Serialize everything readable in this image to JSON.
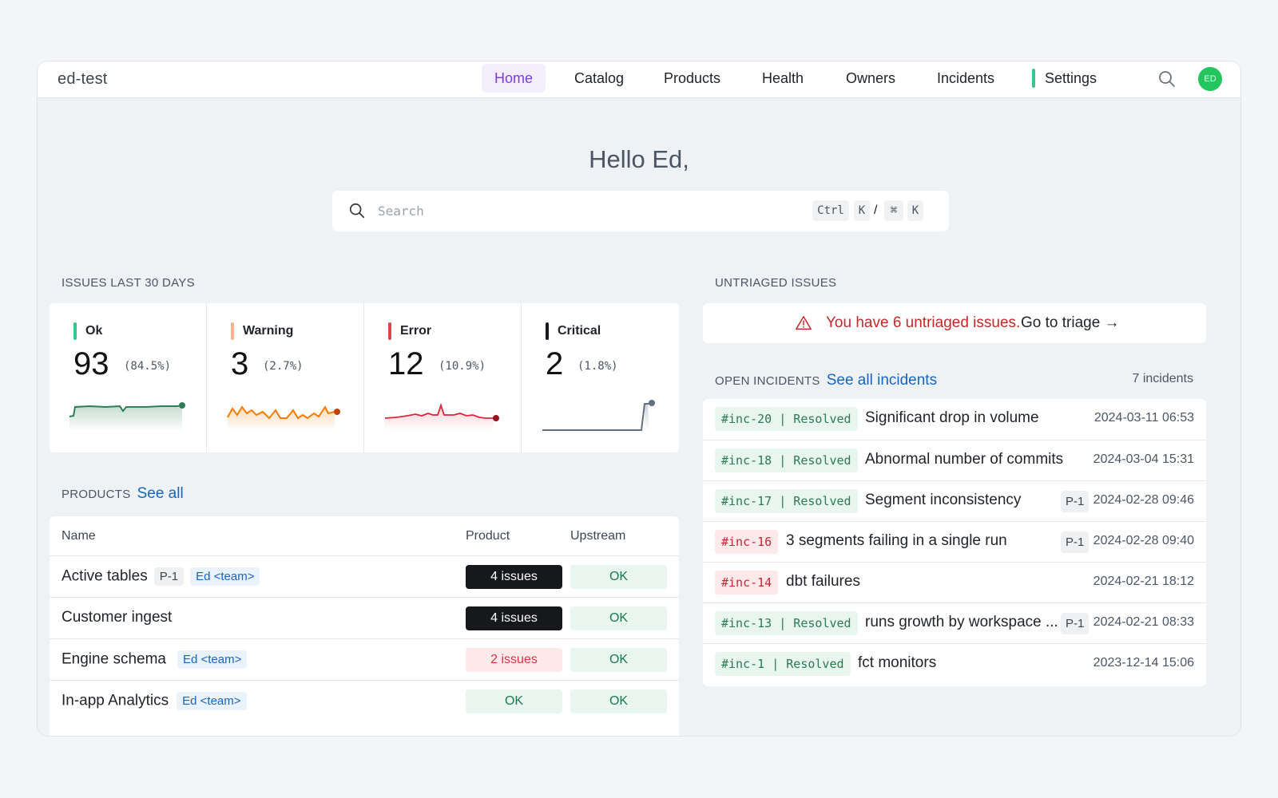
{
  "app": {
    "workspace": "ed-test",
    "avatar_initials": "ED"
  },
  "nav": {
    "items": [
      {
        "label": "Home",
        "active": true
      },
      {
        "label": "Catalog"
      },
      {
        "label": "Products"
      },
      {
        "label": "Health"
      },
      {
        "label": "Owners"
      },
      {
        "label": "Incidents"
      },
      {
        "label": "Settings"
      }
    ]
  },
  "greeting": "Hello Ed,",
  "search": {
    "placeholder": "Search",
    "shortcut": {
      "ctrl": "Ctrl",
      "k": "K",
      "slash": "/",
      "cmd": "⌘",
      "k2": "K"
    }
  },
  "issues": {
    "title": "ISSUES LAST 30 DAYS",
    "stats": [
      {
        "label": "Ok",
        "count": "93",
        "pct": "(84.5%)",
        "color": "#3cc48f"
      },
      {
        "label": "Warning",
        "count": "3",
        "pct": "(2.7%)",
        "color": "#f9b48a"
      },
      {
        "label": "Error",
        "count": "12",
        "pct": "(10.9%)",
        "color": "#e0474c"
      },
      {
        "label": "Critical",
        "count": "2",
        "pct": "(1.8%)",
        "color": "#16181b"
      }
    ]
  },
  "products": {
    "title": "PRODUCTS",
    "see_all": "See all",
    "columns": {
      "name": "Name",
      "product": "Product",
      "upstream": "Upstream"
    },
    "rows": [
      {
        "name": "Active tables",
        "priority": "P-1",
        "team": "Ed <team>",
        "product": "4 issues",
        "product_status": "dark",
        "upstream": "OK"
      },
      {
        "name": "Customer ingest",
        "priority": "",
        "team": "",
        "product": "4 issues",
        "product_status": "dark",
        "upstream": "OK"
      },
      {
        "name": "Engine schema",
        "priority": "",
        "team": "Ed <team>",
        "product": "2 issues",
        "product_status": "err",
        "upstream": "OK"
      },
      {
        "name": "In-app Analytics",
        "priority": "",
        "team": "Ed <team>",
        "product": "OK",
        "product_status": "ok",
        "upstream": "OK"
      }
    ]
  },
  "untriaged": {
    "title": "UNTRIAGED ISSUES",
    "message": "You have 6 untriaged issues.",
    "link": "Go to triage →"
  },
  "incidents": {
    "title": "OPEN INCIDENTS",
    "see_all": "See all incidents",
    "count": "7 incidents",
    "rows": [
      {
        "id": "#inc-20 | Resolved",
        "status": "resolved",
        "title": "Significant drop in volume",
        "priority": "",
        "date": "2024-03-11 06:53"
      },
      {
        "id": "#inc-18 | Resolved",
        "status": "resolved",
        "title": "Abnormal number of commits",
        "priority": "",
        "date": "2024-03-04 15:31"
      },
      {
        "id": "#inc-17 | Resolved",
        "status": "resolved",
        "title": "Segment inconsistency",
        "priority": "P-1",
        "date": "2024-02-28 09:46"
      },
      {
        "id": "#inc-16",
        "status": "open",
        "title": "3 segments failing in a single run",
        "priority": "P-1",
        "date": "2024-02-28 09:40"
      },
      {
        "id": "#inc-14",
        "status": "open",
        "title": "dbt failures",
        "priority": "",
        "date": "2024-02-21 18:12"
      },
      {
        "id": "#inc-13 | Resolved",
        "status": "resolved",
        "title": "runs growth by workspace ...",
        "priority": "P-1",
        "date": "2024-02-21 08:33"
      },
      {
        "id": "#inc-1 | Resolved",
        "status": "resolved",
        "title": "fct monitors",
        "priority": "",
        "date": "2023-12-14 15:06"
      }
    ]
  }
}
